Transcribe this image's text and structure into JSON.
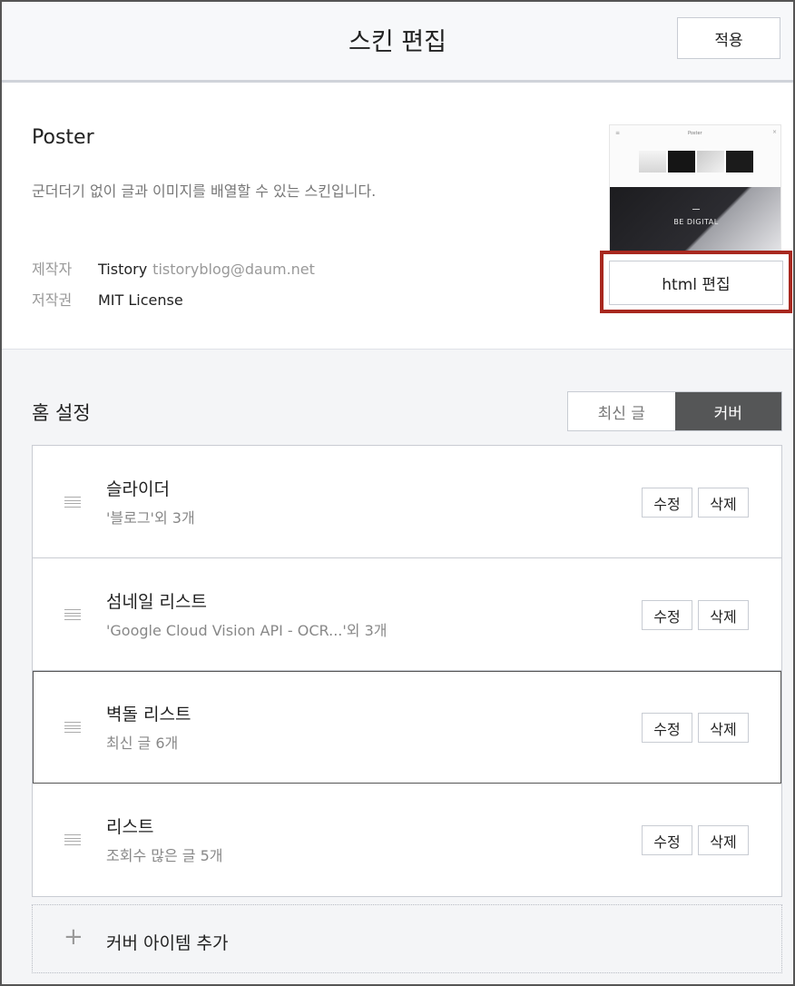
{
  "header": {
    "title": "스킨 편집",
    "apply_label": "적용"
  },
  "skin": {
    "name": "Poster",
    "description": "군더더기 없이 글과 이미지를 배열할 수 있는 스킨입니다.",
    "author_label": "제작자",
    "author_name": "Tistory",
    "author_email": "tistoryblog@daum.net",
    "license_label": "저작권",
    "license_value": "MIT License",
    "thumbnail_caption": "BE DIGITAL",
    "thumbnail_logo": "Poster",
    "html_edit_label": "html 편집"
  },
  "home": {
    "title": "홈 설정",
    "toggle": {
      "option_latest": "최신 글",
      "option_cover": "커버",
      "selected": "커버"
    },
    "items": [
      {
        "title": "슬라이더",
        "subtitle": "'블로그'외 3개",
        "edit_label": "수정",
        "delete_label": "삭제"
      },
      {
        "title": "섬네일 리스트",
        "subtitle": "'Google Cloud Vision API - OCR...'외 3개",
        "edit_label": "수정",
        "delete_label": "삭제"
      },
      {
        "title": "벽돌 리스트",
        "subtitle": "최신 글 6개",
        "edit_label": "수정",
        "delete_label": "삭제"
      },
      {
        "title": "리스트",
        "subtitle": "조회수 많은 글 5개",
        "edit_label": "수정",
        "delete_label": "삭제"
      }
    ],
    "add_item_label": "커버 아이템 추가"
  },
  "colors": {
    "highlight": "#a8281f",
    "toggle_active_bg": "#555657"
  },
  "icons": {
    "drag_handle": "hamburger-lines",
    "add": "plus"
  }
}
